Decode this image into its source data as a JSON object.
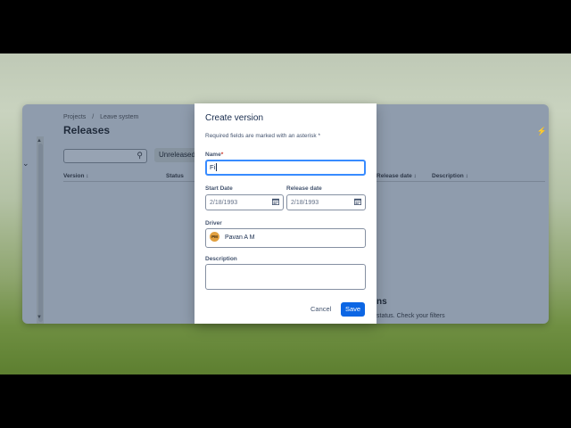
{
  "breadcrumb": {
    "projects": "Projects",
    "separator": "/",
    "project": "Leave system"
  },
  "page": {
    "title": "Releases"
  },
  "toolbar": {
    "filter_label": "Unreleased",
    "search_icon": "search-icon"
  },
  "table": {
    "headers": [
      "Version",
      "Status",
      "Release date",
      "Description"
    ]
  },
  "empty_state": {
    "title": "ns",
    "subtitle": "status. Check your filters"
  },
  "modal": {
    "title": "Create version",
    "required_note": "Required fields are marked with an asterisk *",
    "name": {
      "label": "Name",
      "asterisk": "*",
      "value": "Fi"
    },
    "start_date": {
      "label": "Start Date",
      "value": "2/18/1993"
    },
    "release_date": {
      "label": "Release date",
      "value": "2/18/1993"
    },
    "driver": {
      "label": "Driver",
      "initials": "PM",
      "value": "Pavan A M"
    },
    "description": {
      "label": "Description",
      "value": ""
    },
    "cancel_label": "Cancel",
    "save_label": "Save"
  },
  "colors": {
    "accent": "#0c66e4",
    "focus": "#388bff",
    "avatar": "#e2a03f"
  }
}
